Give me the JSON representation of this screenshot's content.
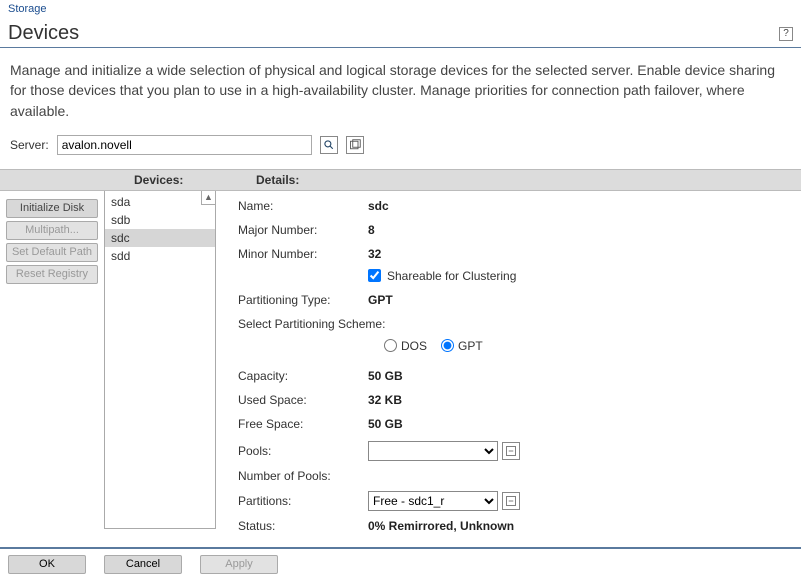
{
  "breadcrumb": "Storage",
  "page_title": "Devices",
  "help_tooltip": "?",
  "intro": "Manage and initialize a wide selection of physical and logical storage devices for the selected server. Enable device sharing for those devices that you plan to use in a high-availability cluster. Manage priorities for connection path failover, where available.",
  "server": {
    "label": "Server:",
    "value": "avalon.novell"
  },
  "columns": {
    "devices": "Devices:",
    "details": "Details:"
  },
  "side_buttons": {
    "initialize": "Initialize Disk",
    "multipath": "Multipath...",
    "set_default": "Set Default Path",
    "reset_registry": "Reset Registry"
  },
  "devices": [
    "sda",
    "sdb",
    "sdc",
    "sdd"
  ],
  "selected_device": "sdc",
  "details": {
    "name_label": "Name:",
    "name_value": "sdc",
    "major_label": "Major Number:",
    "major_value": "8",
    "minor_label": "Minor Number:",
    "minor_value": "32",
    "shareable_label": "Shareable for Clustering",
    "parttype_label": "Partitioning Type:",
    "parttype_value": "GPT",
    "scheme_label": "Select Partitioning Scheme:",
    "scheme_dos": "DOS",
    "scheme_gpt": "GPT",
    "capacity_label": "Capacity:",
    "capacity_value": "50 GB",
    "used_label": "Used Space:",
    "used_value": "32 KB",
    "free_label": "Free Space:",
    "free_value": "50 GB",
    "pools_label": "Pools:",
    "pools_selected": "",
    "numpools_label": "Number of Pools:",
    "numpools_value": "",
    "partitions_label": "Partitions:",
    "partitions_selected": "Free - sdc1_r",
    "status_label": "Status:",
    "status_value": "0% Remirrored, Unknown"
  },
  "footer": {
    "ok": "OK",
    "cancel": "Cancel",
    "apply": "Apply"
  }
}
